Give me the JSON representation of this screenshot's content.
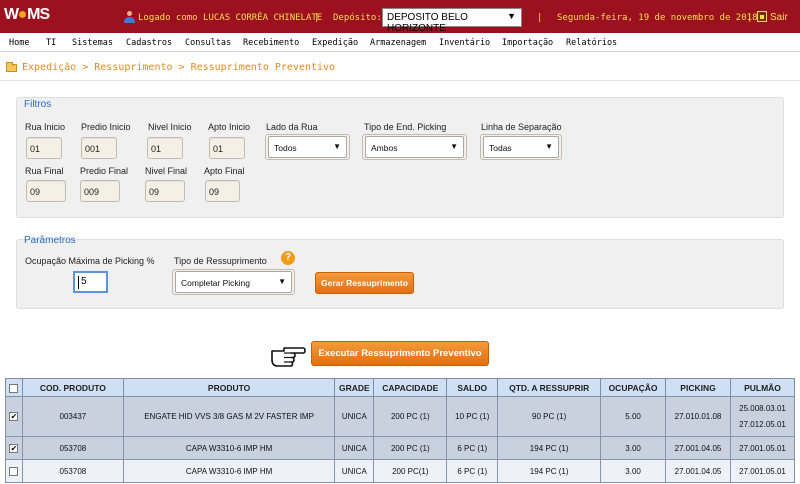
{
  "header": {
    "logo": "WMS",
    "logged_as": "Logado como LUCAS CORRÊA CHINELATE",
    "sep1": "|",
    "deposit_label": "Depósito:",
    "deposit_value": "DEPOSITO BELO HORIZONTE",
    "sep2": "|",
    "date": "Segunda-feira, 19 de novembro de 2018",
    "sep3": "|",
    "exit_label": "Sair",
    "colors": {
      "bar": "#9c1020",
      "text": "#f0e04a"
    }
  },
  "menu": [
    "Home",
    "TI",
    "Sistemas",
    "Cadastros",
    "Consultas",
    "Recebimento",
    "Expedição",
    "Armazenagem",
    "Inventário",
    "Importação",
    "Relatórios"
  ],
  "breadcrumb": "Expedição > Ressuprimento > Ressuprimento Preventivo",
  "filters": {
    "title": "Filtros",
    "rua_inicio": {
      "label": "Rua Inicio",
      "value": "01"
    },
    "predio_inicio": {
      "label": "Predio Inicio",
      "value": "001"
    },
    "nivel_inicio": {
      "label": "Nivel Inicio",
      "value": "01"
    },
    "apto_inicio": {
      "label": "Apto Inicio",
      "value": "01"
    },
    "lado_rua": {
      "label": "Lado da Rua",
      "value": "Todos"
    },
    "tipo_end": {
      "label": "Tipo de End. Picking",
      "value": "Ambos"
    },
    "linha_sep": {
      "label": "Linha de Separação",
      "value": "Todas"
    },
    "rua_final": {
      "label": "Rua Final",
      "value": "09"
    },
    "predio_final": {
      "label": "Predio Final",
      "value": "009"
    },
    "nivel_final": {
      "label": "Nivel Final",
      "value": "09"
    },
    "apto_final": {
      "label": "Apto Final",
      "value": "09"
    }
  },
  "params": {
    "title": "Parâmetros",
    "ocupacao_label": "Ocupação Máxima de Picking %",
    "ocupacao_value": "5",
    "tipo_label": "Tipo de Ressuprimento",
    "tipo_value": "Completar Picking",
    "gerar_label": "Gerar Ressuprimento"
  },
  "execute_label": "Executar Ressuprimento Preventivo",
  "table": {
    "headers": [
      "",
      "COD. PRODUTO",
      "PRODUTO",
      "GRADE",
      "CAPACIDADE",
      "SALDO",
      "QTD. A RESSUPRIR",
      "OCUPAÇÃO",
      "PICKING",
      "PULMÃO"
    ],
    "rows": [
      {
        "checked": true,
        "cod": "003437",
        "produto": "ENGATE HID VVS 3/8 GAS M 2V FASTER IMP",
        "grade": "UNICA",
        "capacidade": "200 PC (1)",
        "saldo": "10 PC (1)",
        "qtd": "90 PC (1)",
        "ocupacao": "5.00",
        "picking": "27.010.01.08",
        "pulmao1": "25.008.03.01",
        "pulmao2": "27.012.05.01"
      },
      {
        "checked": true,
        "cod": "053708",
        "produto": "CAPA W3310-6 IMP HM",
        "grade": "UNICA",
        "capacidade": "200 PC (1)",
        "saldo": "6 PC (1)",
        "qtd": "194 PC (1)",
        "ocupacao": "3.00",
        "picking": "27.001.04.05",
        "pulmao1": "27.001.05.01"
      },
      {
        "checked": false,
        "cod": "053708",
        "produto": "CAPA W3310-6 IMP HM",
        "grade": "UNICA",
        "capacidade": "200 PC(1)",
        "saldo": "6 PC (1)",
        "qtd": "194 PC (1)",
        "ocupacao": "3.00",
        "picking": "27.001.04.05",
        "pulmao1": "27.001.05.01"
      }
    ]
  }
}
